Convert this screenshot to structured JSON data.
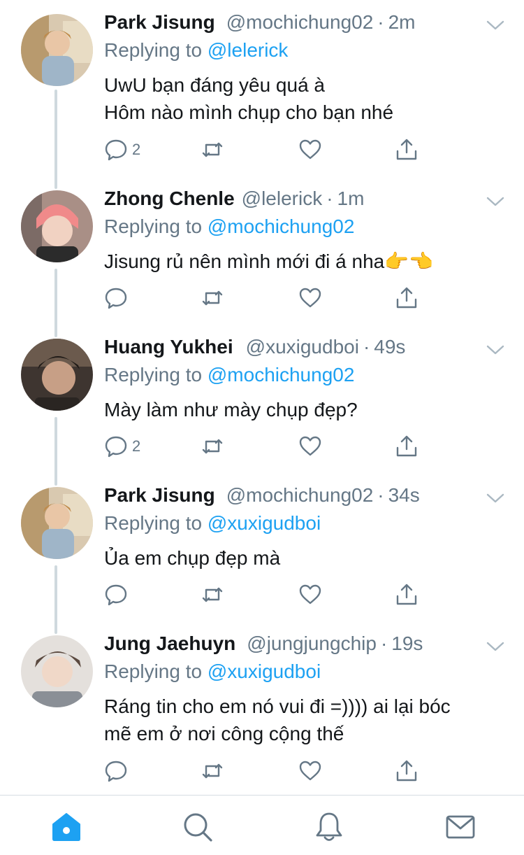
{
  "tweets": [
    {
      "name": "Park Jisung",
      "handle": "@mochichung02",
      "separator": "·",
      "time": "2m",
      "replying_prefix": "Replying to ",
      "replying_to": "@lelerick",
      "text": "UwU bạn đáng yêu quá à\nHôm nào mình chụp cho bạn nhé",
      "reply_count": "2",
      "avatar_color": "#c9a27a"
    },
    {
      "name": "Zhong Chenle",
      "handle": "@lelerick",
      "separator": "·",
      "time": "1m",
      "replying_prefix": "Replying to ",
      "replying_to": "@mochichung02",
      "text": "Jisung rủ nên mình mới đi á nha👉👈",
      "reply_count": "",
      "avatar_color": "#e8a6a0"
    },
    {
      "name": "Huang Yukhei",
      "handle": "@xuxigudboi",
      "separator": "·",
      "time": "49s",
      "replying_prefix": "Replying to ",
      "replying_to": "@mochichung02",
      "text": "Mày làm như mày chụp đẹp?",
      "reply_count": "2",
      "avatar_color": "#5a4a3e"
    },
    {
      "name": "Park Jisung",
      "handle": "@mochichung02",
      "separator": "·",
      "time": "34s",
      "replying_prefix": "Replying to ",
      "replying_to": "@xuxigudboi",
      "text": "Ủa em chụp đẹp mà",
      "reply_count": "",
      "avatar_color": "#c9a27a"
    },
    {
      "name": "Jung Jaehuyn",
      "handle": "@jungjungchip",
      "separator": "·",
      "time": "19s",
      "replying_prefix": "Replying to ",
      "replying_to": "@xuxigudboi",
      "text": "Ráng tin cho em nó vui đi =)))) ai lại bóc\nmẽ em ở nơi công cộng thế",
      "reply_count": "",
      "avatar_color": "#d9d4d0"
    }
  ],
  "icons": {
    "reply": "reply-icon",
    "retweet": "retweet-icon",
    "like": "heart-icon",
    "share": "share-icon",
    "menu": "chevron-down-icon"
  },
  "tabbar": [
    {
      "icon": "home-icon",
      "active": true
    },
    {
      "icon": "search-icon",
      "active": false
    },
    {
      "icon": "bell-icon",
      "active": false
    },
    {
      "icon": "mail-icon",
      "active": false
    }
  ],
  "colors": {
    "accent": "#1da1f2",
    "secondary_text": "#657786",
    "thread_line": "#cfd9de"
  }
}
